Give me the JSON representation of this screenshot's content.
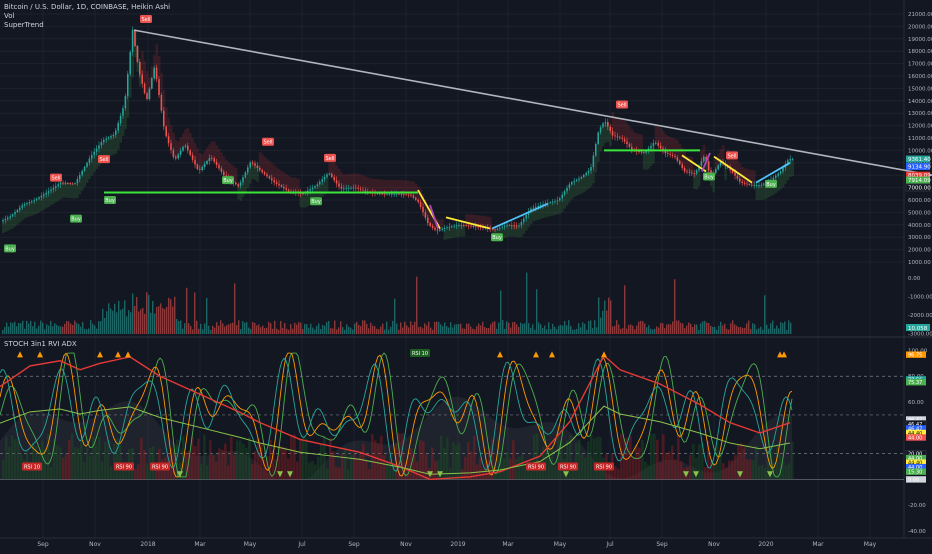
{
  "header": {
    "symbol_line": "Bitcoin / U.S. Dollar, 1D, COINBASE, Heikin Ashi",
    "indicator_1": "Vol",
    "indicator_2": "SuperTrend"
  },
  "lower_pane": {
    "title": "STOCH 3in1 RVI ADX"
  },
  "colors": {
    "background": "#131722",
    "bull": "#26a69a",
    "bear": "#ef5350",
    "supertrend_up": "#4caf50",
    "supertrend_down": "#e53935",
    "trendline": "#b2b5be",
    "support": "#39e639",
    "yellow_trend": "#ffeb3b",
    "cyan_trend": "#4fc3f7",
    "purple_trend": "#ab47bc"
  },
  "chart_data": [
    {
      "type": "line",
      "series_style": "heikin-ashi candlesticks with SuperTrend bands",
      "x_ticks": [
        "Sep",
        "Nov",
        "2018",
        "Mar",
        "May",
        "Jul",
        "Sep",
        "Nov",
        "2019",
        "Mar",
        "May",
        "Jul",
        "Sep",
        "Nov",
        "2020",
        "Mar",
        "May"
      ],
      "y_ticks_price": [
        "21000.00",
        "20000.00",
        "19000.00",
        "18000.00",
        "17000.00",
        "16000.00",
        "15000.00",
        "14000.00",
        "13000.00",
        "12000.00",
        "11000.00",
        "10000.00",
        "9000.00",
        "8000.00",
        "7000.00",
        "6000.00",
        "5000.00",
        "4000.00",
        "3000.00",
        "2000.00",
        "1000.00"
      ],
      "y_ticks_volume": [
        "0.00",
        "-1000.00",
        "-2000.00",
        "-3000.00"
      ],
      "ylim": [
        1000,
        21000
      ],
      "price_path": [
        [
          0,
          4200
        ],
        [
          12,
          4700
        ],
        [
          24,
          5600
        ],
        [
          36,
          6000
        ],
        [
          48,
          6600
        ],
        [
          62,
          7400
        ],
        [
          76,
          7300
        ],
        [
          92,
          9500
        ],
        [
          104,
          10800
        ],
        [
          116,
          11300
        ],
        [
          126,
          13800
        ],
        [
          134,
          19700
        ],
        [
          140,
          16500
        ],
        [
          148,
          14000
        ],
        [
          156,
          16800
        ],
        [
          166,
          11500
        ],
        [
          176,
          9200
        ],
        [
          186,
          10500
        ],
        [
          200,
          8300
        ],
        [
          212,
          9500
        ],
        [
          226,
          7900
        ],
        [
          240,
          7100
        ],
        [
          252,
          9100
        ],
        [
          264,
          8200
        ],
        [
          276,
          7400
        ],
        [
          290,
          6700
        ],
        [
          304,
          6500
        ],
        [
          318,
          7200
        ],
        [
          330,
          8200
        ],
        [
          342,
          6900
        ],
        [
          356,
          7000
        ],
        [
          370,
          6600
        ],
        [
          384,
          6500
        ],
        [
          398,
          6500
        ],
        [
          412,
          6400
        ],
        [
          420,
          5800
        ],
        [
          430,
          4000
        ],
        [
          438,
          3500
        ],
        [
          448,
          3800
        ],
        [
          460,
          4000
        ],
        [
          472,
          3900
        ],
        [
          484,
          3800
        ],
        [
          496,
          3600
        ],
        [
          508,
          4000
        ],
        [
          520,
          3900
        ],
        [
          532,
          5300
        ],
        [
          546,
          5700
        ],
        [
          560,
          6000
        ],
        [
          572,
          7400
        ],
        [
          582,
          7800
        ],
        [
          592,
          8500
        ],
        [
          600,
          11600
        ],
        [
          606,
          12400
        ],
        [
          614,
          11200
        ],
        [
          624,
          10900
        ],
        [
          634,
          10000
        ],
        [
          646,
          9800
        ],
        [
          656,
          10700
        ],
        [
          666,
          9800
        ],
        [
          676,
          9500
        ],
        [
          686,
          8300
        ],
        [
          696,
          8100
        ],
        [
          706,
          9600
        ],
        [
          712,
          7800
        ],
        [
          722,
          9100
        ],
        [
          732,
          8400
        ],
        [
          742,
          7400
        ],
        [
          752,
          7200
        ],
        [
          762,
          7200
        ],
        [
          772,
          7600
        ],
        [
          782,
          8300
        ],
        [
          790,
          9300
        ]
      ],
      "support_lines": [
        {
          "from": [
            104,
            6600
          ],
          "to": [
            418,
            6600
          ]
        },
        {
          "from": [
            604,
            10000
          ],
          "to": [
            700,
            10000
          ]
        }
      ],
      "trend_lines": [
        {
          "color_key": "trendline",
          "from": [
            134,
            19700
          ],
          "to": [
            932,
            8000
          ]
        },
        {
          "color_key": "yellow_trend",
          "from": [
            418,
            6800
          ],
          "to": [
            440,
            3700
          ]
        },
        {
          "color_key": "yellow_trend",
          "from": [
            446,
            4600
          ],
          "to": [
            490,
            3700
          ]
        },
        {
          "color_key": "cyan_trend",
          "from": [
            492,
            3700
          ],
          "to": [
            548,
            5700
          ]
        },
        {
          "color_key": "yellow_trend",
          "from": [
            682,
            9600
          ],
          "to": [
            706,
            8300
          ]
        },
        {
          "color_key": "yellow_trend",
          "from": [
            714,
            9500
          ],
          "to": [
            752,
            7400
          ]
        },
        {
          "color_key": "cyan_trend",
          "from": [
            756,
            7400
          ],
          "to": [
            790,
            9000
          ]
        },
        {
          "color_key": "purple_trend",
          "from": [
            702,
            8300
          ],
          "to": [
            710,
            9800
          ]
        },
        {
          "color_key": "purple_trend",
          "from": [
            430,
            5600
          ],
          "to": [
            438,
            3700
          ]
        }
      ],
      "signals": [
        {
          "kind": "buy",
          "label": "Buy",
          "x": 10,
          "y": 2100
        },
        {
          "kind": "sell",
          "label": "Sell",
          "x": 56,
          "y": 7800
        },
        {
          "kind": "buy",
          "label": "Buy",
          "x": 76,
          "y": 4500
        },
        {
          "kind": "buy",
          "label": "Buy",
          "x": 110,
          "y": 6000
        },
        {
          "kind": "sell",
          "label": "Sell",
          "x": 104,
          "y": 9300
        },
        {
          "kind": "sell",
          "label": "Sell",
          "x": 146,
          "y": 20600
        },
        {
          "kind": "buy",
          "label": "Buy",
          "x": 228,
          "y": 7600
        },
        {
          "kind": "sell",
          "label": "Sell",
          "x": 268,
          "y": 10700
        },
        {
          "kind": "buy",
          "label": "Buy",
          "x": 316,
          "y": 5900
        },
        {
          "kind": "sell",
          "label": "Sell",
          "x": 330,
          "y": 9400
        },
        {
          "kind": "buy",
          "label": "Buy",
          "x": 497,
          "y": 3000
        },
        {
          "kind": "sell",
          "label": "Sell",
          "x": 622,
          "y": 13700
        },
        {
          "kind": "buy",
          "label": "Buy",
          "x": 709,
          "y": 7900
        },
        {
          "kind": "sell",
          "label": "Sell",
          "x": 732,
          "y": 9600
        },
        {
          "kind": "buy",
          "label": "Buy",
          "x": 771,
          "y": 7300
        }
      ],
      "price_labels": [
        {
          "text": "9361.40",
          "y": 9300,
          "color": "#26a69a"
        },
        {
          "text": "9134.90",
          "y": 8700,
          "color": "#2962ff"
        },
        {
          "text": "8039.09",
          "y": 8000,
          "color": "#e53935"
        },
        {
          "text": "7914.09",
          "y": 7600,
          "color": "#4caf50"
        },
        {
          "text": "7000.00",
          "y": 7000,
          "color": "#131722"
        }
      ],
      "volume_label": "10.058"
    },
    {
      "type": "line",
      "title": "STOCH 3in1 RVI ADX",
      "y_ticks": [
        "100.00",
        "80.00",
        "60.00",
        "40.00",
        "20.00",
        "0.00",
        "-20.00",
        "-40.00"
      ],
      "ylim": [
        -40,
        105
      ],
      "levels": [
        80,
        50,
        20,
        0
      ],
      "value_labels": [
        {
          "text": "96.75",
          "y": 96.75,
          "color": "#ff9800"
        },
        {
          "text": "77.56",
          "y": 77.56,
          "color": "#26a69a"
        },
        {
          "text": "75.37",
          "y": 75.37,
          "color": "#4caf50"
        },
        {
          "text": "46.47",
          "y": 46.47,
          "color": "#d1d4dc"
        },
        {
          "text": "46.47",
          "y": 43.0,
          "color": "#131722"
        },
        {
          "text": "46.47",
          "y": 39.5,
          "color": "#2962ff"
        },
        {
          "text": "44.40",
          "y": 36.0,
          "color": "#ffeb3b"
        },
        {
          "text": "44.00",
          "y": 32.5,
          "color": "#ef5350"
        },
        {
          "text": "20.00",
          "y": 20.0,
          "color": "#131722"
        },
        {
          "text": "44.00",
          "y": 16.5,
          "color": "#4caf50"
        },
        {
          "text": "44.40",
          "y": 13.0,
          "color": "#ffeb3b"
        },
        {
          "text": "44.00",
          "y": 9.5,
          "color": "#2962ff"
        },
        {
          "text": "15.30",
          "y": 6.0,
          "color": "#4caf50"
        },
        {
          "text": "0.00",
          "y": 0.0,
          "color": "#d1d4dc"
        }
      ],
      "adx_path": [
        [
          0,
          72
        ],
        [
          30,
          88
        ],
        [
          60,
          92
        ],
        [
          80,
          85
        ],
        [
          100,
          90
        ],
        [
          130,
          95
        ],
        [
          160,
          80
        ],
        [
          200,
          66
        ],
        [
          240,
          52
        ],
        [
          260,
          44
        ],
        [
          300,
          31
        ],
        [
          330,
          26
        ],
        [
          360,
          21
        ],
        [
          400,
          10
        ],
        [
          430,
          0
        ],
        [
          470,
          2
        ],
        [
          500,
          6
        ],
        [
          540,
          18
        ],
        [
          570,
          45
        ],
        [
          590,
          75
        ],
        [
          604,
          96
        ],
        [
          620,
          85
        ],
        [
          660,
          74
        ],
        [
          700,
          58
        ],
        [
          730,
          44
        ],
        [
          760,
          36
        ],
        [
          790,
          44
        ]
      ],
      "rsi_badges": [
        {
          "text": "RSI 10",
          "x": 420,
          "y": 98,
          "color": "#1b5e20"
        },
        {
          "text": "RSI 10",
          "x": 32,
          "y": 10,
          "color": "#c62828"
        },
        {
          "text": "RSI 90",
          "x": 124,
          "y": 10,
          "color": "#c62828"
        },
        {
          "text": "RSI 90",
          "x": 160,
          "y": 10,
          "color": "#c62828"
        },
        {
          "text": "RSI 90",
          "x": 536,
          "y": 10,
          "color": "#c62828"
        },
        {
          "text": "RSI 90",
          "x": 568,
          "y": 10,
          "color": "#c62828"
        },
        {
          "text": "RSI 90",
          "x": 604,
          "y": 10,
          "color": "#c62828"
        }
      ]
    }
  ]
}
